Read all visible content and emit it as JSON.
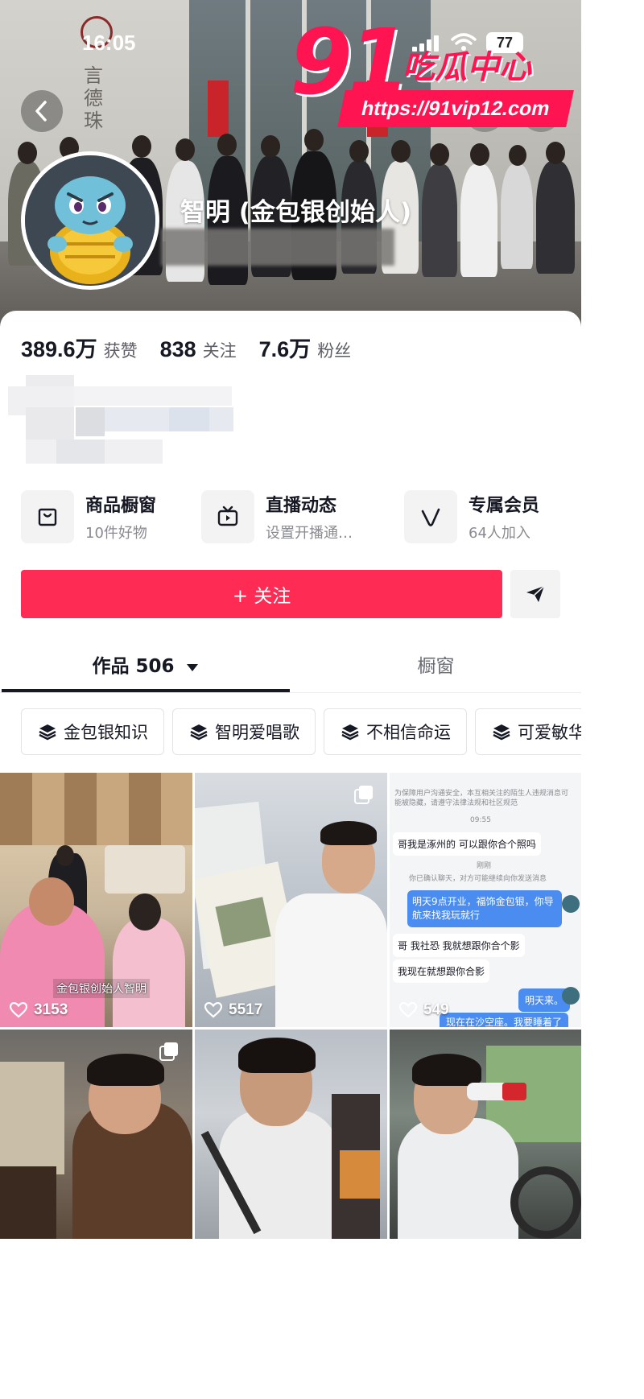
{
  "status_bar": {
    "time": "16:05",
    "battery": "77"
  },
  "watermark": {
    "number": "91",
    "brand": "吃瓜中心",
    "url": "https://91vip12.com"
  },
  "header": {
    "shop_sign_text": "言德珠"
  },
  "profile": {
    "name": "智明 (金包银创始人)"
  },
  "stats": [
    {
      "value": "389.6万",
      "label": "获赞"
    },
    {
      "value": "838",
      "label": "关注"
    },
    {
      "value": "7.6万",
      "label": "粉丝"
    }
  ],
  "features": [
    {
      "title": "商品橱窗",
      "subtitle": "10件好物",
      "icon": "shopping-bag-icon"
    },
    {
      "title": "直播动态",
      "subtitle": "设置开播通…",
      "icon": "tv-icon"
    },
    {
      "title": "专属会员",
      "subtitle": "64人加入",
      "icon": "v-badge-icon"
    }
  ],
  "follow_button": {
    "label": "+ 关注"
  },
  "tabs": [
    {
      "label": "作品 506",
      "active": true
    },
    {
      "label": "橱窗",
      "active": false
    }
  ],
  "collections": [
    "金包银知识",
    "智明爱唱歌",
    "不相信命运",
    "可爱敏华"
  ],
  "videos": [
    {
      "likes": "3153",
      "caption": "金包银创始人智明"
    },
    {
      "likes": "5517"
    },
    {
      "likes": "549",
      "chat": {
        "notice": "为保障用户沟通安全，本互相关注的陌生人违规消息可能被隐藏，请遵守法律法规和社区规范",
        "time": "09:55",
        "msg1": "哥我是涿州的 可以跟你合个照吗",
        "mid": "刚刚",
        "system": "你已确认聊天，对方可能继续向你发送消息",
        "reply": "明天9点开业，福饰金包银，你导航来找我玩就行",
        "msg2": "哥 我社恐 我就想跟你合个影",
        "msg3": "我现在就想跟你合影",
        "reply2": "明天来。",
        "reply3": "现在在沙空座。我要睡着了"
      }
    },
    {
      "likes": ""
    },
    {
      "likes": ""
    },
    {
      "likes": ""
    }
  ],
  "colors": {
    "accent": "#fe2c55",
    "watermark": "#ff1452",
    "text": "#161823",
    "muted": "#8a8b91"
  }
}
